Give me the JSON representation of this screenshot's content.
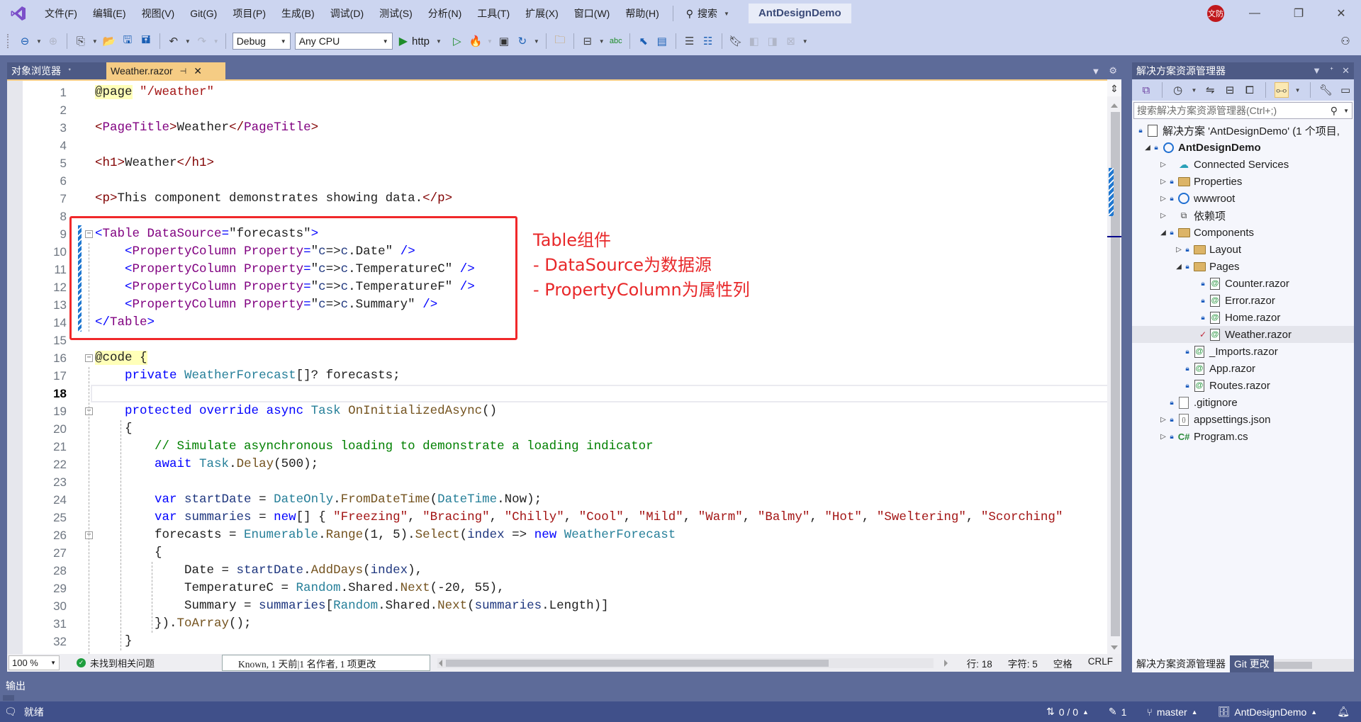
{
  "titlebar": {
    "menu": [
      "文件(F)",
      "编辑(E)",
      "视图(V)",
      "Git(G)",
      "项目(P)",
      "生成(B)",
      "调试(D)",
      "测试(S)",
      "分析(N)",
      "工具(T)",
      "扩展(X)",
      "窗口(W)",
      "帮助(H)"
    ],
    "search_label": "搜索",
    "solution_name": "AntDesignDemo",
    "avatar_text": "文防",
    "accent_color": "#68217a"
  },
  "toolbar": {
    "configuration": "Debug",
    "platform": "Any CPU",
    "run_target": "http"
  },
  "doc_tabs": [
    {
      "label": "对象浏览器",
      "active": false
    },
    {
      "label": "Weather.razor",
      "active": true
    }
  ],
  "editor": {
    "current_line": 18,
    "lines": [
      {
        "n": 1,
        "html": "<span class='dir'>@page</span> <span class='s'>\"/weather\"</span>"
      },
      {
        "n": 2,
        "html": ""
      },
      {
        "n": 3,
        "html": "<span class='tag'>&lt;</span><span class='comp'>PageTitle</span><span class='tag'>&gt;</span>Weather<span class='tag'>&lt;/</span><span class='comp'>PageTitle</span><span class='tag'>&gt;</span>"
      },
      {
        "n": 4,
        "html": ""
      },
      {
        "n": 5,
        "html": "<span class='tag'>&lt;h1&gt;</span>Weather<span class='tag'>&lt;/h1&gt;</span>"
      },
      {
        "n": 6,
        "html": ""
      },
      {
        "n": 7,
        "html": "<span class='tag'>&lt;p&gt;</span>This component demonstrates showing data.<span class='tag'>&lt;/p&gt;</span>"
      },
      {
        "n": 8,
        "html": ""
      },
      {
        "n": 9,
        "html": "<span class='blue'>&lt;</span><span class='comp'>Table</span> <span class='attr'>DataSource</span><span class='blue'>=</span>\"forecasts\"<span class='blue'>&gt;</span>"
      },
      {
        "n": 10,
        "html": "    <span class='blue'>&lt;</span><span class='comp'>PropertyColumn</span> <span class='attr'>Property</span><span class='blue'>=</span>\"<span class='v'>c</span>=&gt;<span class='v'>c</span>.Date\" <span class='blue'>/&gt;</span>"
      },
      {
        "n": 11,
        "html": "    <span class='blue'>&lt;</span><span class='comp'>PropertyColumn</span> <span class='attr'>Property</span><span class='blue'>=</span>\"<span class='v'>c</span>=&gt;<span class='v'>c</span>.TemperatureC\" <span class='blue'>/&gt;</span>"
      },
      {
        "n": 12,
        "html": "    <span class='blue'>&lt;</span><span class='comp'>PropertyColumn</span> <span class='attr'>Property</span><span class='blue'>=</span>\"<span class='v'>c</span>=&gt;<span class='v'>c</span>.TemperatureF\" <span class='blue'>/&gt;</span>"
      },
      {
        "n": 13,
        "html": "    <span class='blue'>&lt;</span><span class='comp'>PropertyColumn</span> <span class='attr'>Property</span><span class='blue'>=</span>\"<span class='v'>c</span>=&gt;<span class='v'>c</span>.Summary\" <span class='blue'>/&gt;</span>"
      },
      {
        "n": 14,
        "html": "<span class='blue'>&lt;/</span><span class='comp'>Table</span><span class='blue'>&gt;</span>"
      },
      {
        "n": 15,
        "html": ""
      },
      {
        "n": 16,
        "html": "<span class='dir'>@code {</span>"
      },
      {
        "n": 17,
        "html": "    <span class='k'>private</span> <span class='t'>WeatherForecast</span>[]? forecasts;"
      },
      {
        "n": 18,
        "html": ""
      },
      {
        "n": 19,
        "html": "    <span class='k'>protected</span> <span class='k'>override</span> <span class='k'>async</span> <span class='t'>Task</span> <span class='m'>OnInitializedAsync</span>()"
      },
      {
        "n": 20,
        "html": "    {"
      },
      {
        "n": 21,
        "html": "        <span class='c'>// Simulate asynchronous loading to demonstrate a loading indicator</span>"
      },
      {
        "n": 22,
        "html": "        <span class='k'>await</span> <span class='t'>Task</span>.<span class='m'>Delay</span>(500);"
      },
      {
        "n": 23,
        "html": ""
      },
      {
        "n": 24,
        "html": "        <span class='k'>var</span> <span class='v'>startDate</span> = <span class='t'>DateOnly</span>.<span class='m'>FromDateTime</span>(<span class='t'>DateTime</span>.Now);"
      },
      {
        "n": 25,
        "html": "        <span class='k'>var</span> <span class='v'>summaries</span> = <span class='k'>new</span>[] { <span class='s'>\"Freezing\"</span>, <span class='s'>\"Bracing\"</span>, <span class='s'>\"Chilly\"</span>, <span class='s'>\"Cool\"</span>, <span class='s'>\"Mild\"</span>, <span class='s'>\"Warm\"</span>, <span class='s'>\"Balmy\"</span>, <span class='s'>\"Hot\"</span>, <span class='s'>\"Sweltering\"</span>, <span class='s'>\"Scorching\"</span>"
      },
      {
        "n": 26,
        "html": "        forecasts = <span class='t'>Enumerable</span>.<span class='m'>Range</span>(1, 5).<span class='m'>Select</span>(<span class='v'>index</span> =&gt; <span class='k'>new</span> <span class='t'>WeatherForecast</span>"
      },
      {
        "n": 27,
        "html": "        {"
      },
      {
        "n": 28,
        "html": "            Date = <span class='v'>startDate</span>.<span class='m'>AddDays</span>(<span class='v'>index</span>),"
      },
      {
        "n": 29,
        "html": "            TemperatureC = <span class='t'>Random</span>.Shared.<span class='m'>Next</span>(-20, 55),"
      },
      {
        "n": 30,
        "html": "            Summary = <span class='v'>summaries</span>[<span class='t'>Random</span>.Shared.<span class='m'>Next</span>(<span class='v'>summaries</span>.Length)]"
      },
      {
        "n": 31,
        "html": "        }).<span class='m'>ToArray</span>();"
      },
      {
        "n": 32,
        "html": "    }"
      }
    ],
    "annotation": [
      "Table组件",
      "- DataSource为数据源",
      "- PropertyColumn为属性列"
    ]
  },
  "editor_status": {
    "zoom": "100 %",
    "issues": "未找到相关问题",
    "git_blame": "Known, 1 天前|1 名作者, 1 项更改",
    "line": "行: 18",
    "char": "字符: 5",
    "indent": "空格",
    "eol": "CRLF"
  },
  "solution_explorer": {
    "title": "解决方案资源管理器",
    "search_placeholder": "搜索解决方案资源管理器(Ctrl+;)",
    "items": [
      {
        "label": "解决方案 'AntDesignDemo' (1 个项目,",
        "icon": "solution-icon",
        "level": 0,
        "expander": "",
        "lock": true
      },
      {
        "label": "AntDesignDemo",
        "icon": "web-project-icon",
        "level": 1,
        "expander": "expanded",
        "lock": true,
        "bold": true
      },
      {
        "label": "Connected Services",
        "icon": "connected-services-icon",
        "level": 2,
        "expander": "collapsed",
        "lock": false
      },
      {
        "label": "Properties",
        "icon": "properties-folder-icon",
        "level": 2,
        "expander": "collapsed",
        "lock": true
      },
      {
        "label": "wwwroot",
        "icon": "globe-icon",
        "level": 2,
        "expander": "collapsed",
        "lock": true
      },
      {
        "label": "依赖项",
        "icon": "dependencies-icon",
        "level": 2,
        "expander": "collapsed",
        "lock": false
      },
      {
        "label": "Components",
        "icon": "folder-icon",
        "level": 2,
        "expander": "expanded",
        "lock": true
      },
      {
        "label": "Layout",
        "icon": "folder-icon",
        "level": 3,
        "expander": "collapsed",
        "lock": true
      },
      {
        "label": "Pages",
        "icon": "folder-icon",
        "level": 3,
        "expander": "expanded",
        "lock": true
      },
      {
        "label": "Counter.razor",
        "icon": "razor-file-icon",
        "level": 4,
        "expander": "",
        "lock": true
      },
      {
        "label": "Error.razor",
        "icon": "razor-file-icon",
        "level": 4,
        "expander": "",
        "lock": true
      },
      {
        "label": "Home.razor",
        "icon": "razor-file-icon",
        "level": 4,
        "expander": "",
        "lock": true
      },
      {
        "label": "Weather.razor",
        "icon": "razor-file-icon",
        "level": 4,
        "expander": "",
        "lock": false,
        "modified": true,
        "selected": true
      },
      {
        "label": "_Imports.razor",
        "icon": "razor-file-icon",
        "level": 3,
        "expander": "",
        "lock": true
      },
      {
        "label": "App.razor",
        "icon": "razor-file-icon",
        "level": 3,
        "expander": "",
        "lock": true
      },
      {
        "label": "Routes.razor",
        "icon": "razor-file-icon",
        "level": 3,
        "expander": "",
        "lock": true
      },
      {
        "label": ".gitignore",
        "icon": "file-icon",
        "level": 2,
        "expander": "",
        "lock": true
      },
      {
        "label": "appsettings.json",
        "icon": "json-file-icon",
        "level": 2,
        "expander": "collapsed",
        "lock": true
      },
      {
        "label": "Program.cs",
        "icon": "csharp-file-icon",
        "level": 2,
        "expander": "collapsed",
        "lock": true
      }
    ]
  },
  "panel_tabs": [
    {
      "label": "解决方案资源管理器",
      "active": true
    },
    {
      "label": "Git 更改",
      "active": false
    }
  ],
  "output": {
    "label": "输出"
  },
  "statusbar": {
    "ready": "就绪",
    "sync": "0 / 0",
    "changes": "1",
    "branch": "master",
    "repo": "AntDesignDemo"
  }
}
